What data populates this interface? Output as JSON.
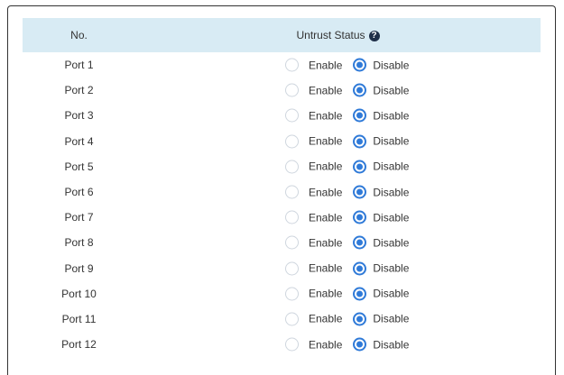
{
  "table": {
    "headers": {
      "no": "No.",
      "status": "Untrust Status"
    },
    "help_icon_glyph": "?",
    "options": {
      "enable": "Enable",
      "disable": "Disable"
    },
    "rows": [
      {
        "port": "Port 1",
        "selected": "Disable"
      },
      {
        "port": "Port 2",
        "selected": "Disable"
      },
      {
        "port": "Port 3",
        "selected": "Disable"
      },
      {
        "port": "Port 4",
        "selected": "Disable"
      },
      {
        "port": "Port 5",
        "selected": "Disable"
      },
      {
        "port": "Port 6",
        "selected": "Disable"
      },
      {
        "port": "Port 7",
        "selected": "Disable"
      },
      {
        "port": "Port 8",
        "selected": "Disable"
      },
      {
        "port": "Port 9",
        "selected": "Disable"
      },
      {
        "port": "Port 10",
        "selected": "Disable"
      },
      {
        "port": "Port 11",
        "selected": "Disable"
      },
      {
        "port": "Port 12",
        "selected": "Disable"
      }
    ]
  },
  "colors": {
    "header_bg": "#d8ebf4",
    "radio_accent": "#2f7ad8",
    "help_icon_bg": "#1f2f48"
  }
}
